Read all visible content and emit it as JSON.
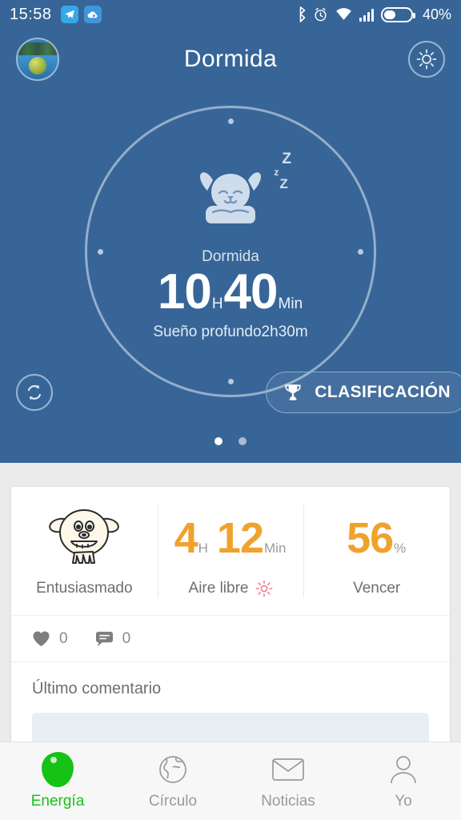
{
  "statusbar": {
    "time": "15:58",
    "battery_percent": "40%",
    "icons": [
      "telegram-icon",
      "cloud-icon",
      "bluetooth-icon",
      "alarm-icon",
      "wifi-icon",
      "signal-icon",
      "battery-icon"
    ]
  },
  "header": {
    "title": "Dormida",
    "avatar_name": "user-avatar",
    "brightness_icon": "sun-icon"
  },
  "sleep": {
    "state_label": "Dormida",
    "hours": "10",
    "hours_unit": "H",
    "minutes": "40",
    "minutes_unit": "Min",
    "deep_sleep": "Sueño profundo2h30m",
    "mascot_icon": "sleeping-bunny-icon",
    "zzz": [
      "Z",
      "z",
      "Z"
    ]
  },
  "hero_controls": {
    "sync_label": "sync-icon",
    "ranking_label": "CLASIFICACIÓN",
    "trophy_icon": "trophy-icon",
    "page_dots": 2,
    "active_dot": 0
  },
  "stats": [
    {
      "name": "mood",
      "icon": "sheep-face-icon",
      "caption": "Entusiasmado",
      "value": "",
      "unit": ""
    },
    {
      "name": "outdoor",
      "icon": "sun-pink-icon",
      "caption": "Aire libre",
      "value1": "4",
      "unit1": "H",
      "value2": "12",
      "unit2": "Min"
    },
    {
      "name": "goal",
      "icon": "",
      "caption": "Vencer",
      "value": "56",
      "unit": "%"
    }
  ],
  "social": {
    "likes_icon": "heart-icon",
    "likes_count": "0",
    "comments_icon": "comment-icon",
    "comments_count": "0"
  },
  "comments": {
    "label": "Último comentario",
    "input_placeholder": ""
  },
  "bottomnav": {
    "items": [
      {
        "label": "Energía",
        "icon": "energy-icon",
        "active": true
      },
      {
        "label": "Círculo",
        "icon": "globe-icon",
        "active": false
      },
      {
        "label": "Noticias",
        "icon": "envelope-icon",
        "active": false
      },
      {
        "label": "Yo",
        "icon": "person-icon",
        "active": false
      }
    ]
  },
  "colors": {
    "header_blue": "#376597",
    "accent_orange": "#f0a22c",
    "active_green": "#17c217",
    "page_bg": "#ebebeb"
  }
}
